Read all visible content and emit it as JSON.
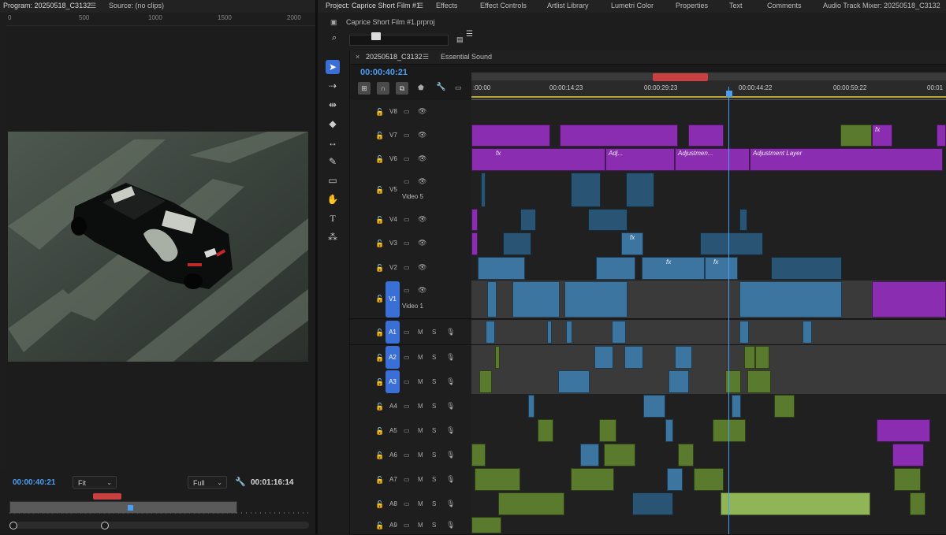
{
  "program": {
    "tab_label": "Program: 20250518_C3132",
    "source_tab": "Source: (no clips)",
    "ruler_ticks": [
      "0",
      "500",
      "1000",
      "1500",
      "2000"
    ],
    "timecode_current": "00:00:40:21",
    "fit_option": "Fit",
    "resolution_option": "Full",
    "timecode_duration": "00:01:16:14"
  },
  "top_tabs": [
    "Project: Caprice Short Film #1",
    "Effects",
    "Effect Controls",
    "Artlist Library",
    "Lumetri Color",
    "Properties",
    "Text",
    "Comments",
    "Audio Track Mixer: 20250518_C3132"
  ],
  "project": {
    "file_name": "Caprice Short Film #1.prproj"
  },
  "sequence": {
    "tab_label": "20250518_C3132",
    "secondary_tab": "Essential Sound",
    "timecode": "00:00:40:21",
    "ruler_labels": [
      ":00:00",
      "00:00:14:23",
      "00:00:29:23",
      "00:00:44:22",
      "00:00:59:22",
      "00:01"
    ],
    "video_tracks": [
      {
        "id": "V8",
        "name": ""
      },
      {
        "id": "V7",
        "name": ""
      },
      {
        "id": "V6",
        "name": ""
      },
      {
        "id": "V5",
        "name": "Video 5"
      },
      {
        "id": "V4",
        "name": ""
      },
      {
        "id": "V3",
        "name": ""
      },
      {
        "id": "V2",
        "name": ""
      },
      {
        "id": "V1",
        "name": "Video 1"
      }
    ],
    "audio_tracks": [
      "A1",
      "A2",
      "A3",
      "A4",
      "A5",
      "A6",
      "A7",
      "A8",
      "A9"
    ],
    "mute_label": "M",
    "solo_label": "S",
    "adjustment_labels": [
      "Adj...",
      "Adjustmen...",
      "Adjustment Layer"
    ],
    "fx_label": "fx"
  },
  "colors": {
    "accent": "#4a9ff5",
    "video_clip": "#3c76a0",
    "adjustment_clip": "#8a2db0",
    "audio_clip": "#5a7a2e",
    "playbar_marker": "#c94040"
  }
}
